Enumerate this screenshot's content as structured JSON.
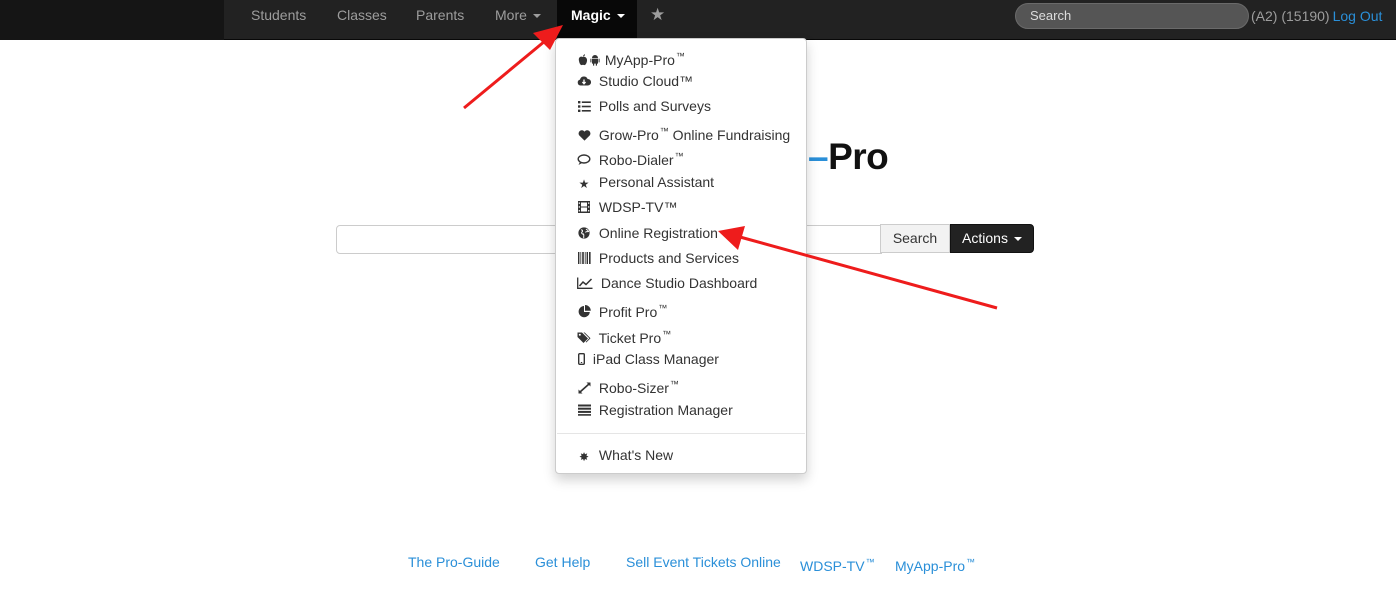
{
  "nav": {
    "links": [
      {
        "label": "Students"
      },
      {
        "label": "Classes"
      },
      {
        "label": "Parents"
      },
      {
        "label": "More"
      },
      {
        "label": "Magic"
      }
    ],
    "search_placeholder": "Search",
    "user_info": "(A2) (15190)",
    "logout": "Log Out"
  },
  "logo": {
    "dash": "–",
    "text": "Pro"
  },
  "main": {
    "search_button": "Search",
    "actions_button": "Actions"
  },
  "menu": {
    "items": [
      {
        "label": "MyApp-Pro",
        "tm": "™",
        "icon": "apple-android-icon"
      },
      {
        "label": "Studio Cloud™",
        "icon": "cloud-download-icon"
      },
      {
        "label": "Polls and Surveys",
        "icon": "list-icon"
      },
      {
        "label": "Grow-Pro",
        "tm": "™",
        "label_suffix": " Online Fundraising",
        "icon": "heart-icon"
      },
      {
        "label": "Robo-Dialer",
        "tm": "™",
        "icon": "comment-icon"
      },
      {
        "label": "Personal Assistant",
        "icon": "star-icon"
      },
      {
        "label": "WDSP-TV™",
        "icon": "film-icon"
      },
      {
        "label": "Online Registration",
        "icon": "globe-icon"
      },
      {
        "label": "Products and Services",
        "icon": "barcode-icon"
      },
      {
        "label": "Dance Studio Dashboard",
        "icon": "line-chart-icon"
      },
      {
        "label": "Profit Pro",
        "tm": "™",
        "icon": "pie-chart-icon"
      },
      {
        "label": "Ticket Pro",
        "tm": "™",
        "icon": "tags-icon"
      },
      {
        "label": "iPad Class Manager",
        "icon": "mobile-icon"
      },
      {
        "label": "Robo-Sizer",
        "tm": "™",
        "icon": "resize-icon"
      },
      {
        "label": "Registration Manager",
        "icon": "tasks-icon"
      }
    ],
    "whats_new": {
      "label": "What's New",
      "icon": "asterisk-icon"
    }
  },
  "footer": {
    "links": [
      {
        "label": "The Pro-Guide"
      },
      {
        "label": "Get Help"
      },
      {
        "label": "Sell Event Tickets Online"
      },
      {
        "label": "WDSP-TV",
        "tm": "™"
      },
      {
        "label": "MyApp-Pro",
        "tm": "™"
      }
    ]
  },
  "colors": {
    "navbar": "#222222",
    "link": "#2a8fd8",
    "arrow": "#ee1c1c"
  }
}
